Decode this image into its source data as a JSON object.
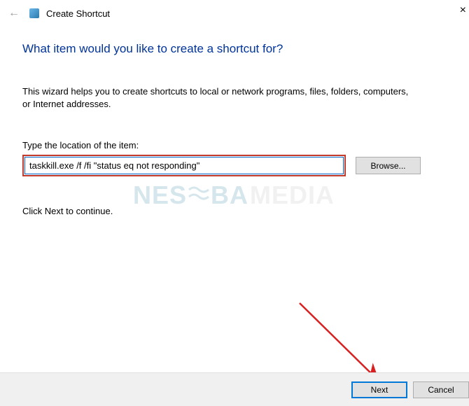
{
  "header": {
    "title": "Create Shortcut"
  },
  "main": {
    "heading": "What item would you like to create a shortcut for?",
    "description": "This wizard helps you to create shortcuts to local or network programs, files, folders, computers, or Internet addresses.",
    "location_label": "Type the location of the item:",
    "location_value": "taskkill.exe /f /fi \"status eq not responding\"",
    "browse_label": "Browse...",
    "continue_text": "Click Next to continue."
  },
  "footer": {
    "next_label": "Next",
    "cancel_label": "Cancel"
  },
  "watermark": {
    "part1": "NES",
    "part2": "BA",
    "part3": "MEDIA"
  }
}
